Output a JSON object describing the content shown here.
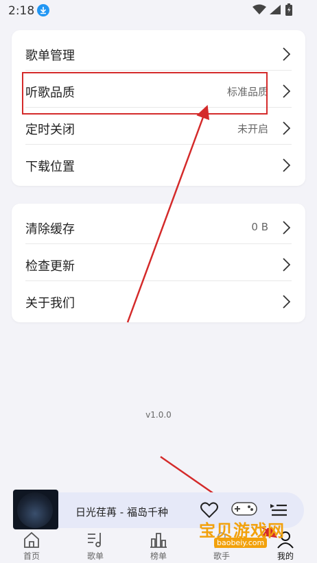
{
  "status_bar": {
    "time": "2:18"
  },
  "settings_group_1": {
    "items": [
      {
        "label": "歌单管理",
        "value": ""
      },
      {
        "label": "听歌品质",
        "value": "标准品质"
      },
      {
        "label": "定时关闭",
        "value": "未开启"
      },
      {
        "label": "下载位置",
        "value": ""
      }
    ]
  },
  "settings_group_2": {
    "items": [
      {
        "label": "清除缓存",
        "value": "0 B"
      },
      {
        "label": "检查更新",
        "value": ""
      },
      {
        "label": "关于我们",
        "value": ""
      }
    ]
  },
  "version": "v1.0.0",
  "player": {
    "title": "日光荏苒 - 福岛千种"
  },
  "nav": {
    "items": [
      {
        "label": "首页",
        "icon": "home-icon"
      },
      {
        "label": "歌单",
        "icon": "playlist-icon"
      },
      {
        "label": "榜单",
        "icon": "chart-icon"
      },
      {
        "label": "歌手",
        "icon": "singer-icon"
      },
      {
        "label": "我的",
        "icon": "profile-icon"
      }
    ],
    "active": "我的"
  },
  "watermark": {
    "text": "宝贝游戏网",
    "url": "baobeiy.com"
  },
  "colors": {
    "annotation_red": "#d42a2a",
    "accent_blue": "#2196f3",
    "player_bg": "#e6e9f8"
  }
}
